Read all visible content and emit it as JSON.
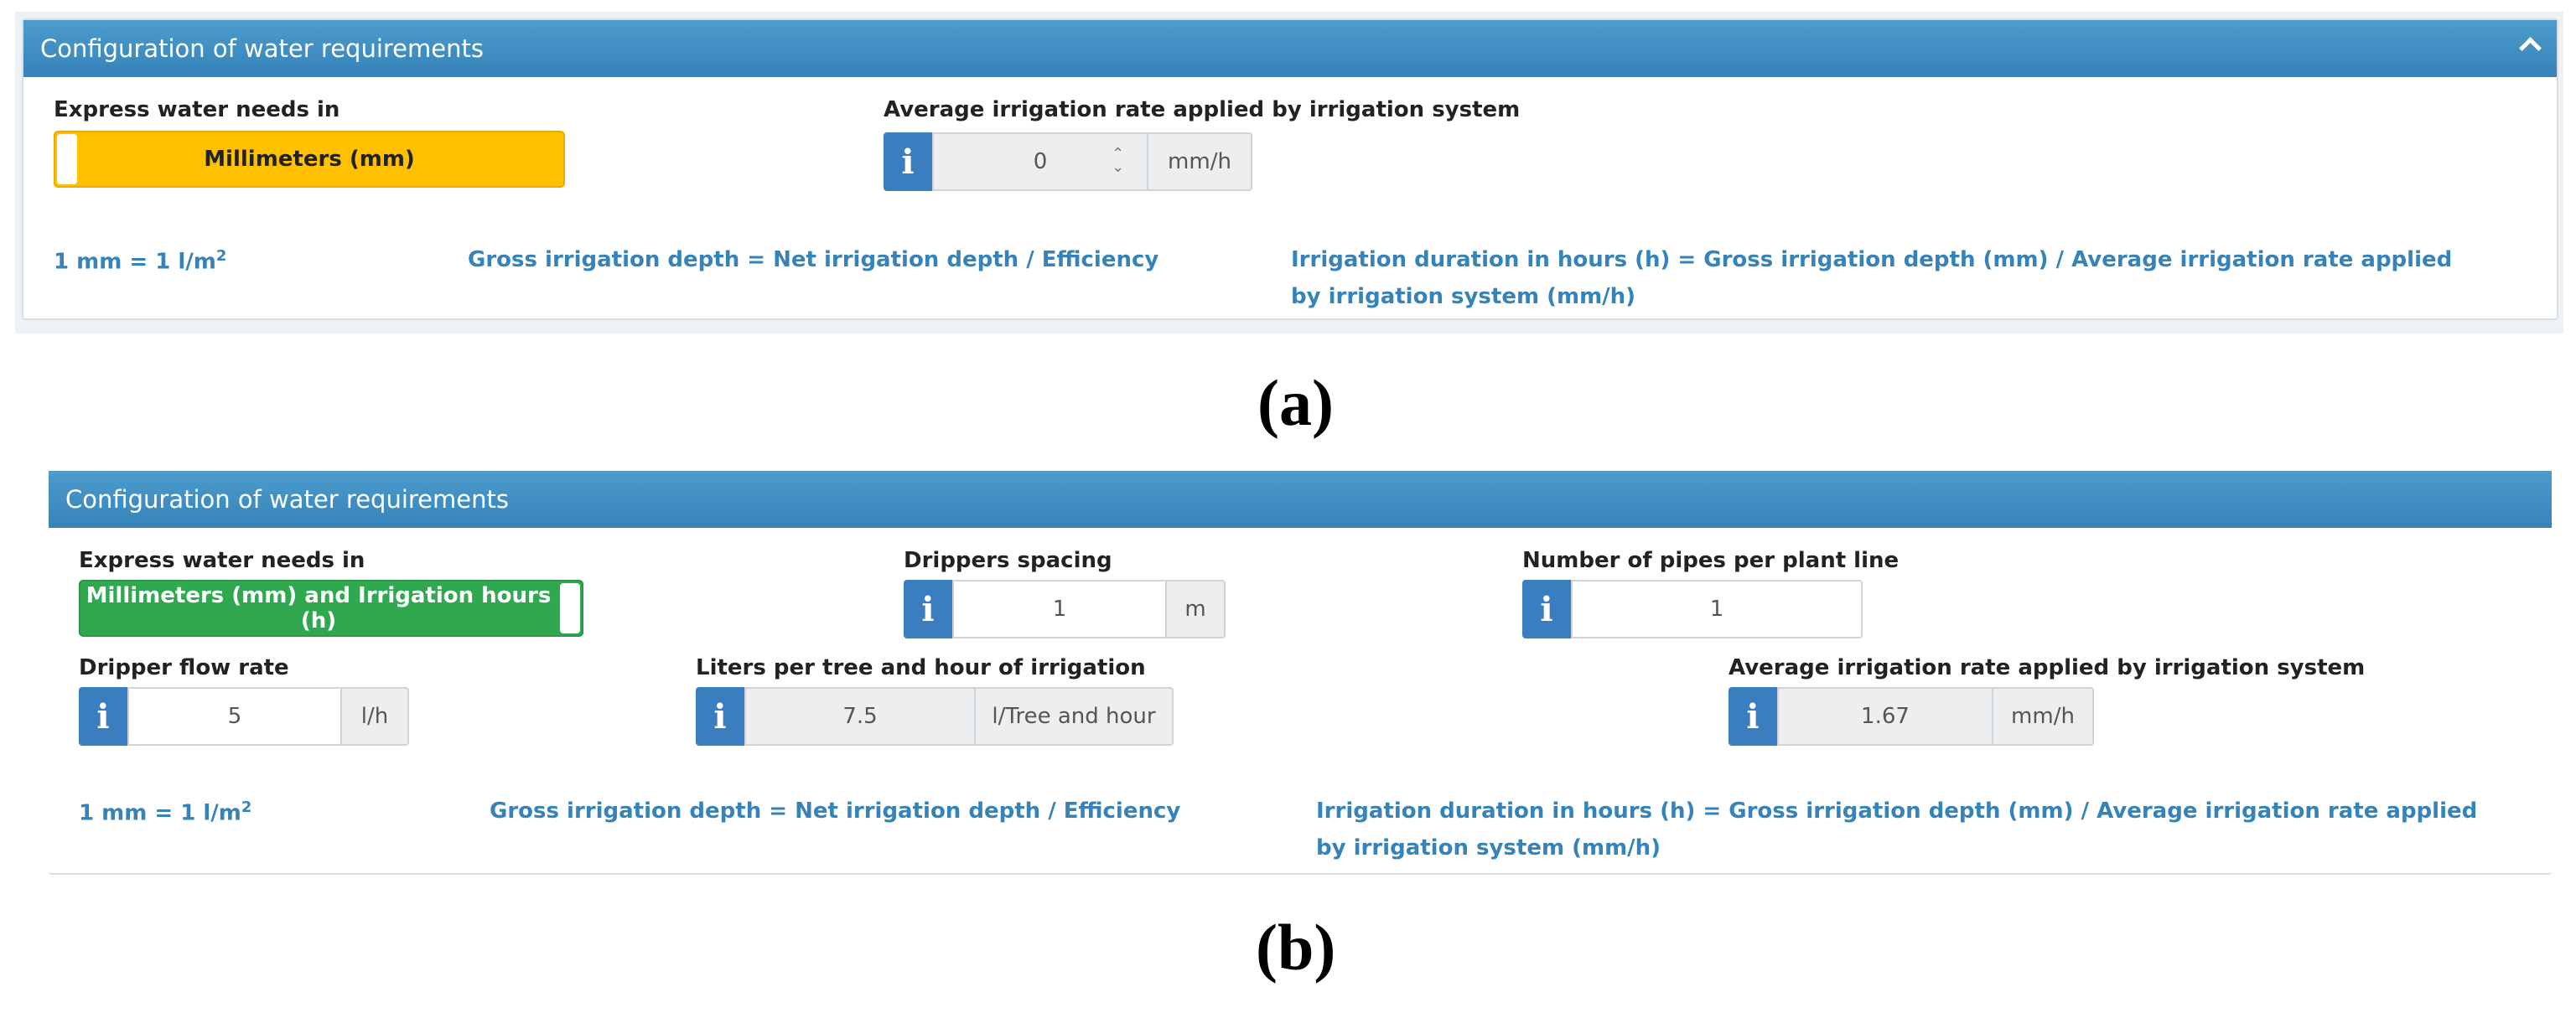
{
  "panel_a": {
    "title": "Configuration of water requirements",
    "express_label": "Express water needs in",
    "toggle_label": "Millimeters (mm)",
    "avg_rate_label": "Average irrigation rate applied by irrigation system",
    "avg_rate_value": "0",
    "avg_rate_unit": "mm/h",
    "formula_1": "1 mm = 1 l/m",
    "formula_1_sup": "2",
    "formula_2": "Gross irrigation depth = Net irrigation depth / Efficiency",
    "formula_3": "Irrigation duration in hours (h) = Gross irrigation depth (mm) / Average irrigation rate applied by irrigation system (mm/h)",
    "caption": "(a)"
  },
  "panel_b": {
    "title": "Configuration of water requirements",
    "express_label": "Express water needs in",
    "toggle_label": "Millimeters (mm) and Irrigation hours (h)",
    "drippers_spacing_label": "Drippers spacing",
    "drippers_spacing_value": "1",
    "drippers_spacing_unit": "m",
    "pipes_label": "Number of pipes per plant line",
    "pipes_value": "1",
    "dripper_flow_label": "Dripper flow rate",
    "dripper_flow_value": "5",
    "dripper_flow_unit": "l/h",
    "liters_label": "Liters per tree and hour of irrigation",
    "liters_value": "7.5",
    "liters_unit": "l/Tree and hour",
    "avg_rate_label": "Average irrigation rate applied by irrigation system",
    "avg_rate_value": "1.67",
    "avg_rate_unit": "mm/h",
    "formula_1": "1 mm = 1 l/m",
    "formula_1_sup": "2",
    "formula_2": "Gross irrigation depth = Net irrigation depth / Efficiency",
    "formula_3": "Irrigation duration in hours (h) = Gross irrigation depth (mm) / Average irrigation rate applied by irrigation system (mm/h)",
    "caption": "(b)"
  },
  "icons": {
    "info": "info-icon",
    "collapse": "chevron-up-icon",
    "spinner": "spinner-arrows-icon"
  },
  "colors": {
    "header": "#3e8dc1",
    "toggle_yellow": "#ffc000",
    "toggle_green": "#2fa84f",
    "info_button": "#3a7ebf",
    "formula_text": "#3583b8"
  }
}
